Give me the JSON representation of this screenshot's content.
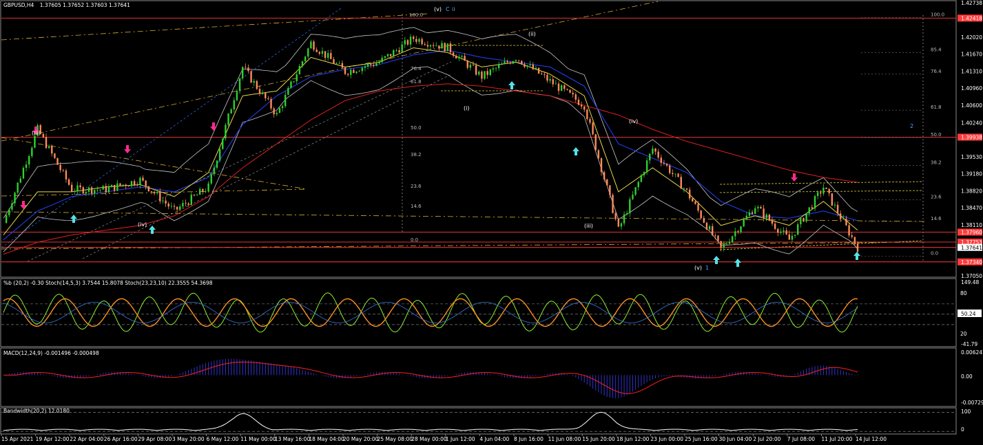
{
  "window": {
    "title": "GBPUSD,H4",
    "ohlc": "1.37605 1.37652 1.37603 1.37641"
  },
  "colors": {
    "background": "#000000",
    "bull_candle": "#2fd12f",
    "bear_candle": "#ff8c5a",
    "ma_red": "#e02020",
    "ma_blue": "#2244ff",
    "ma_yellow": "#e8d84a",
    "bands": "#c8c8c8",
    "fib": "#e0b030",
    "level_red": "#ff3b3b",
    "arrow_up": "#55e0e8",
    "arrow_down": "#ff2a90",
    "stoch_green": "#90ee30",
    "stoch_orange": "#ff9020",
    "macd_hist": "#3333cc",
    "macd_signal": "#ff2020"
  },
  "chart_data": [
    {
      "type": "candlestick",
      "panel": "price",
      "x": [
        "15 Apr 2021",
        "19 Apr 12:00",
        "22 Apr 04:00",
        "26 Apr 16:00",
        "29 Apr 08:00",
        "3 May 20:00",
        "6 May 12:00",
        "11 May 00:00",
        "13 May 16:00",
        "18 May 04:00",
        "20 May 20:00",
        "25 May 08:00",
        "28 May 00:00",
        "1 Jun 12:00",
        "4 Jun 04:00",
        "8 Jun 16:00",
        "11 Jun 08:00",
        "15 Jun 20:00",
        "18 Jun 12:00",
        "23 Jun 00:00",
        "25 Jun 16:00",
        "30 Jun 04:00",
        "2 Jul 20:00",
        "7 Jul 08:00",
        "11 Jul 20:00",
        "14 Jul 12:00"
      ],
      "close": [
        1.3815,
        1.401,
        1.3885,
        1.3885,
        1.3905,
        1.384,
        1.389,
        1.414,
        1.404,
        1.419,
        1.413,
        1.415,
        1.42,
        1.418,
        1.412,
        1.416,
        1.411,
        1.406,
        1.38,
        1.397,
        1.388,
        1.376,
        1.385,
        1.378,
        1.389,
        1.3764
      ],
      "moving_averages": {
        "red": [
          1.375,
          1.3775,
          1.379,
          1.38,
          1.381,
          1.383,
          1.387,
          1.393,
          1.398,
          1.403,
          1.407,
          1.409,
          1.41,
          1.4105,
          1.41,
          1.409,
          1.408,
          1.406,
          1.404,
          1.401,
          1.3985,
          1.3965,
          1.3945,
          1.3925,
          1.391,
          1.39
        ],
        "blue": [
          1.378,
          1.384,
          1.387,
          1.388,
          1.389,
          1.388,
          1.391,
          1.402,
          1.408,
          1.412,
          1.4135,
          1.4145,
          1.4165,
          1.4175,
          1.416,
          1.415,
          1.414,
          1.41,
          1.398,
          1.395,
          1.392,
          1.386,
          1.383,
          1.3825,
          1.384,
          1.382
        ],
        "yellow": [
          1.379,
          1.388,
          1.388,
          1.389,
          1.3895,
          1.387,
          1.392,
          1.408,
          1.409,
          1.416,
          1.414,
          1.415,
          1.418,
          1.417,
          1.414,
          1.415,
          1.4125,
          1.408,
          1.388,
          1.393,
          1.388,
          1.381,
          1.383,
          1.381,
          1.386,
          1.38
        ]
      },
      "horizontal_levels": [
        1.42418,
        1.39938,
        1.3796,
        1.37753,
        1.37641,
        1.3734
      ],
      "fib_levels": [
        {
          "label": "100.0",
          "value": 1.4243
        },
        {
          "label": "85.4",
          "value": 1.417
        },
        {
          "label": "76.4",
          "value": 1.4125
        },
        {
          "label": "61.8",
          "value": 1.405
        },
        {
          "label": "50.0",
          "value": 1.3993
        },
        {
          "label": "38.2",
          "value": 1.3935
        },
        {
          "label": "23.6",
          "value": 1.3863
        },
        {
          "label": "14.6",
          "value": 1.3818
        },
        {
          "label": "0.0",
          "value": 1.3746
        }
      ],
      "ylim": [
        1.3705,
        1.42738
      ],
      "yticks": [
        1.42738,
        1.4202,
        1.4167,
        1.4131,
        1.4096,
        1.406,
        1.4024,
        1.3953,
        1.3918,
        1.3882,
        1.3847,
        1.3811,
        1.3705
      ],
      "price_tags": [
        "1.42418",
        "1.39938",
        "1.37960",
        "1.37753",
        "1.37641",
        "1.37340"
      ],
      "wave_labels": [
        "(iii)",
        "(iv)",
        "(v)",
        "C",
        "ii",
        "(i)",
        "(ii)",
        "(iv)",
        "(iii)",
        "(v)",
        "1",
        "2"
      ],
      "fib_labels_left": [
        "100.0",
        "76.4",
        "61.8",
        "50.0",
        "38.2",
        "23.6",
        "14.6",
        "0.0"
      ]
    },
    {
      "type": "line",
      "panel": "oscillator",
      "header": "%b (20,2) -0.30   Stoch(14,5,3) 3.7544 15.8078   Stoch(23,23,10) 22.3555 54.3698",
      "ylim": [
        -41.79,
        149.48
      ],
      "yticks": [
        "149.48",
        "50.24",
        "-41.79"
      ],
      "right_marks": [
        "80",
        "20"
      ],
      "levels": [
        80,
        50.24,
        20
      ]
    },
    {
      "type": "bar",
      "panel": "macd",
      "header": "MACD(12,24,9) -0.001496 -0.000498",
      "ylim": [
        -0.007292,
        0.006247
      ],
      "yticks": [
        "0.006247",
        "0.00",
        "-0.007292"
      ]
    },
    {
      "type": "line",
      "panel": "bandwidth",
      "header": "Bandwidth(20,2) 12.0180",
      "right_marks": [
        "100",
        "0"
      ]
    }
  ]
}
